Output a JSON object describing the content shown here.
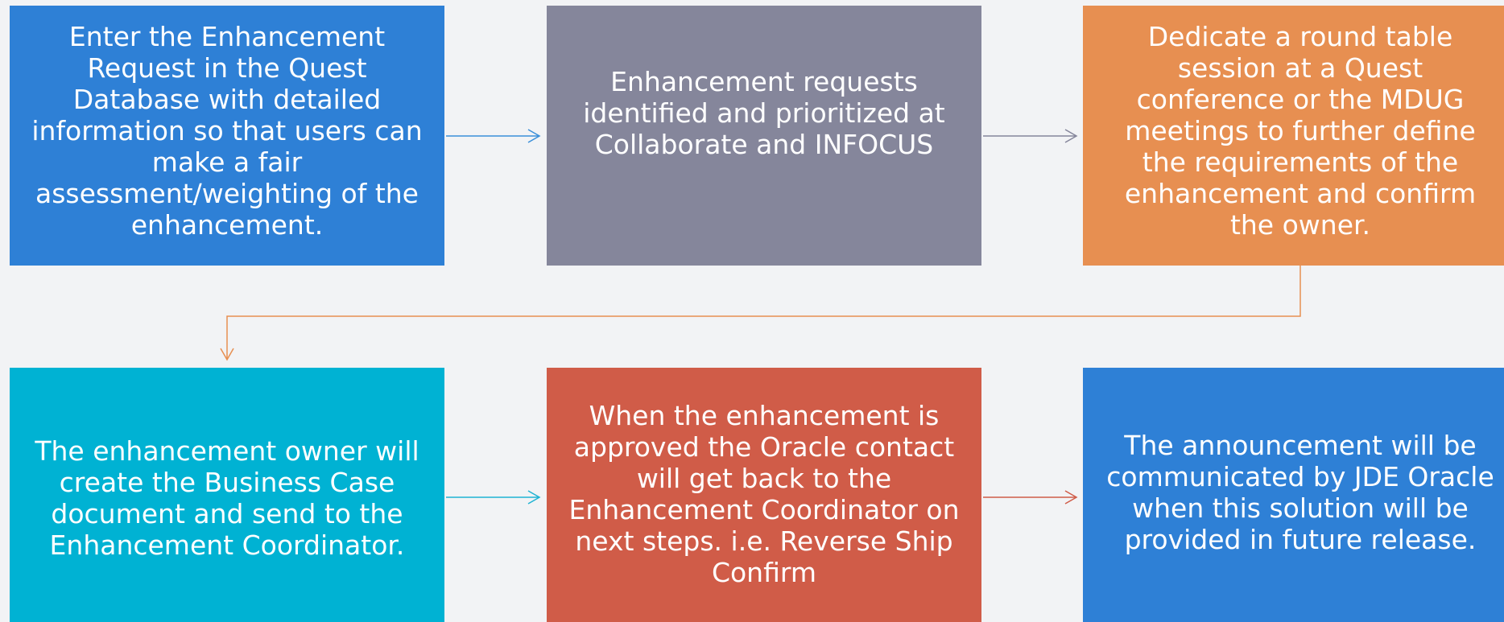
{
  "colors": {
    "background": "#f2f3f5",
    "box_blue": "#2e80d6",
    "box_gray": "#85869b",
    "box_orange": "#e78f51",
    "box_cyan": "#00b2d3",
    "box_red": "#d05c48",
    "arrow_blue": "#3a8fd9",
    "arrow_gray": "#85869b",
    "arrow_orange": "#e78f51",
    "arrow_cyan": "#1fb3d3",
    "arrow_red": "#d05c48"
  },
  "steps": [
    {
      "text": "Enter the Enhancement Request in the Quest Database with detailed information so that users can make a fair assessment/weighting of the enhancement."
    },
    {
      "text": "Enhancement requests identified and prioritized at Collaborate and INFOCUS"
    },
    {
      "text": "Dedicate a round table session at a Quest conference or the MDUG meetings to further define the requirements of the enhancement and confirm the owner."
    },
    {
      "text": "The enhancement owner will create the Business Case document and send to the Enhancement Coordinator."
    },
    {
      "text": "When the enhancement is approved the Oracle contact will get back to the Enhancement Coordinator on next steps. i.e. Reverse Ship Confirm"
    },
    {
      "text": "The announcement will be communicated by JDE Oracle when this solution will be provided in future release."
    }
  ],
  "connectors": [
    {
      "from": 1,
      "to": 2,
      "color_key": "arrow_blue"
    },
    {
      "from": 2,
      "to": 3,
      "color_key": "arrow_gray"
    },
    {
      "from": 3,
      "to": 4,
      "color_key": "arrow_orange"
    },
    {
      "from": 4,
      "to": 5,
      "color_key": "arrow_cyan"
    },
    {
      "from": 5,
      "to": 6,
      "color_key": "arrow_red"
    }
  ]
}
